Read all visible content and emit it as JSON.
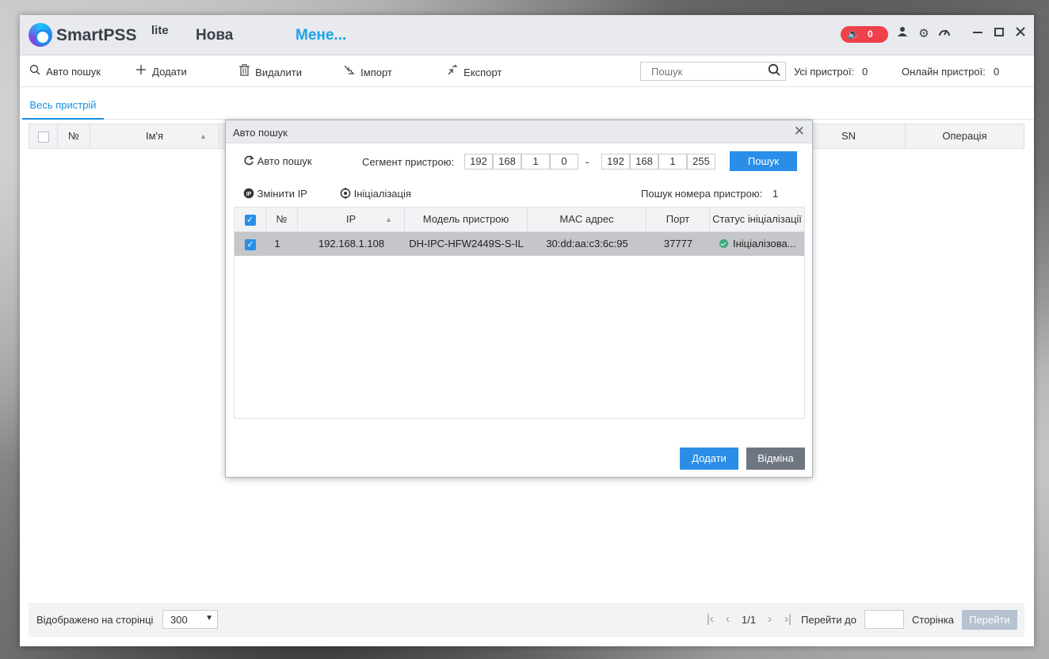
{
  "app": {
    "name": "SmartPSS",
    "name_sup": "lite",
    "tabs": [
      "Нова",
      "Мене..."
    ],
    "alarm_count": "0"
  },
  "toolbar": {
    "auto_search": "Авто пошук",
    "add": "Додати",
    "delete": "Видалити",
    "import": "Імпорт",
    "export": "Експорт",
    "search_placeholder": "Пошук",
    "all_devices_label": "Усі пристрої:",
    "all_devices_count": "0",
    "online_devices_label": "Онлайн пристрої:",
    "online_devices_count": "0"
  },
  "device_tabs": [
    "Весь пристрій"
  ],
  "main_table": {
    "columns": [
      "№",
      "Ім'я",
      "SN",
      "Операція"
    ]
  },
  "footer": {
    "per_page_label": "Відображено на сторінці",
    "per_page_value": "300",
    "page_indicator": "1/1",
    "goto_label": "Перейти до",
    "page_label": "Сторінка",
    "goto_button": "Перейти"
  },
  "dialog": {
    "title": "Авто пошук",
    "auto_search": "Авто пошук",
    "segment_label": "Сегмент пристрою:",
    "ip_start": [
      "192",
      "168",
      "1",
      "0"
    ],
    "ip_end": [
      "192",
      "168",
      "1",
      "255"
    ],
    "search_button": "Пошук",
    "change_ip": "Змінити IP",
    "initialize": "Ініціалізація",
    "found_label": "Пошук номера пристрою:",
    "found_count": "1",
    "columns": [
      "№",
      "IP",
      "Модель пристрою",
      "MAC адрес",
      "Порт",
      "Статус ініціалізації"
    ],
    "rows": [
      {
        "no": "1",
        "ip": "192.168.1.108",
        "model": "DH-IPC-HFW2449S-S-IL",
        "mac": "30:dd:aa:c3:6c:95",
        "port": "37777",
        "status": "Ініціалізова..."
      }
    ],
    "add_button": "Додати",
    "cancel_button": "Відміна"
  }
}
